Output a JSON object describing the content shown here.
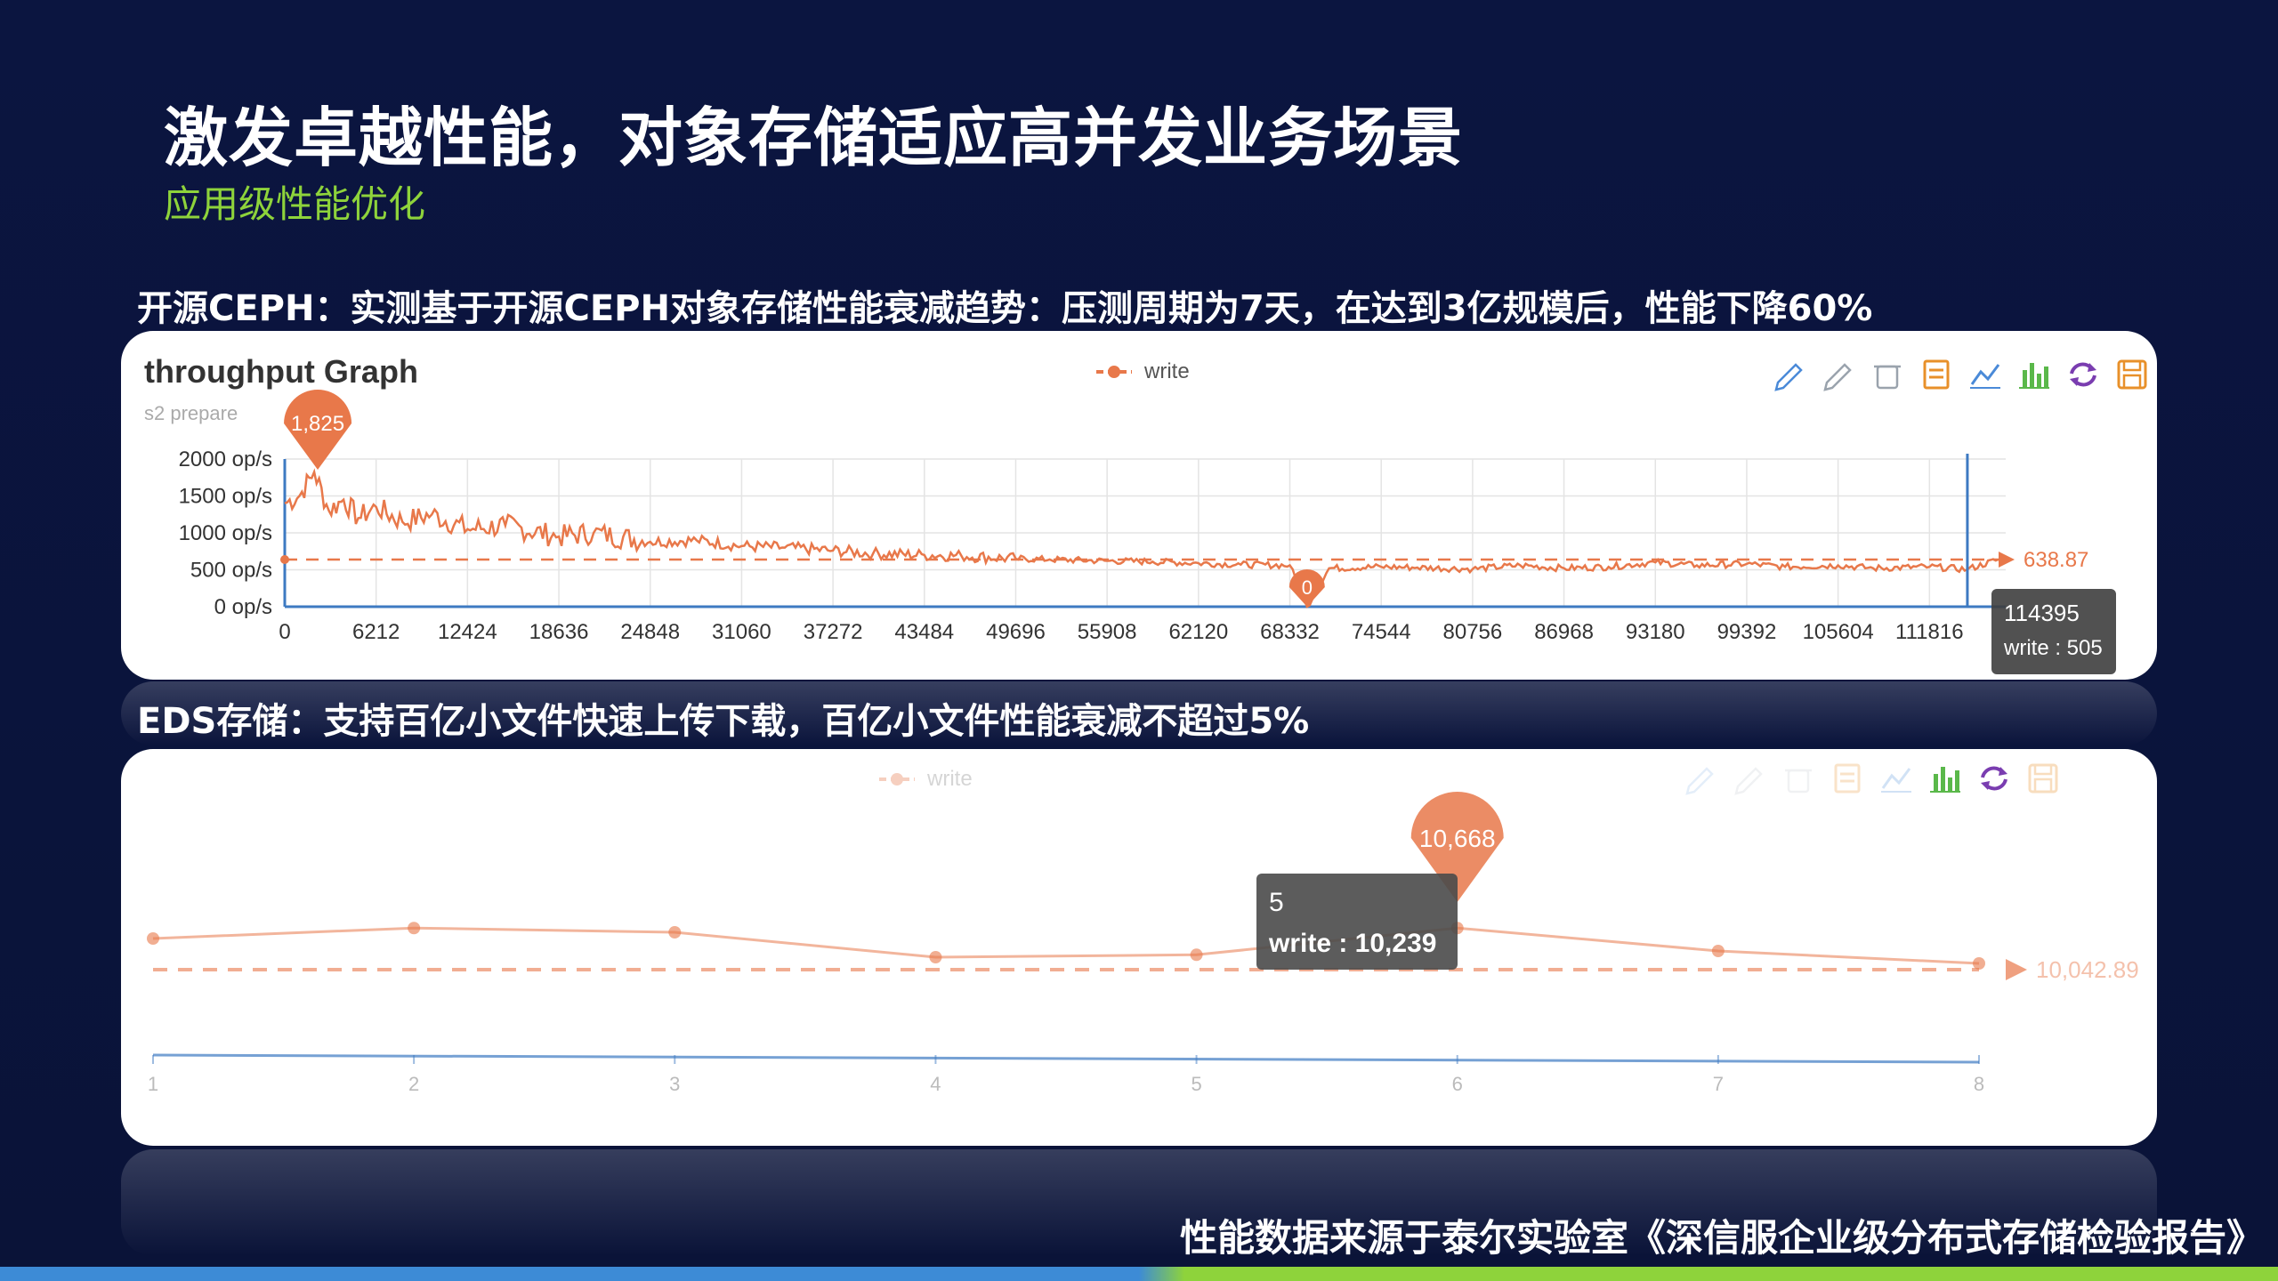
{
  "slide": {
    "title": "激发卓越性能，对象存储适应高并发业务场景",
    "subtitle": "应用级性能优化",
    "ceph_heading": "开源CEPH：实测基于开源CEPH对象存储性能衰减趋势：压测周期为7天，在达到3亿规模后，性能下降60%",
    "eds_heading": "EDS存储：支持百亿小文件快速上传下载，百亿小文件性能衰减不超过5%",
    "footer_note": "性能数据来源于泰尔实验室《深信服企业级分布式存储检验报告》"
  },
  "colors": {
    "series": "#e8784a",
    "axis": "#3d7ac2",
    "title": "#ffffff",
    "subtitle": "#8ed33b",
    "background": "#0b1540"
  },
  "toolbar_icons": [
    "mark-pen-icon",
    "erase-pen-icon",
    "clear-icon",
    "data-view-icon",
    "line-chart-icon",
    "bar-chart-icon",
    "refresh-icon",
    "save-icon"
  ],
  "chart_data": [
    {
      "type": "line",
      "title": "throughput Graph",
      "subtitle": "s2 prepare",
      "legend": [
        "write"
      ],
      "legend_position": "top-center",
      "y_ticks": [
        "2000 op/s",
        "1500 op/s",
        "1000 op/s",
        "500 op/s",
        "0 op/s"
      ],
      "ylim": [
        0,
        2000
      ],
      "x_ticks": [
        "0",
        "6212",
        "12424",
        "18636",
        "24848",
        "31060",
        "37272",
        "43484",
        "49696",
        "55908",
        "62120",
        "68332",
        "74544",
        "80756",
        "86968",
        "93180",
        "99392",
        "105604",
        "111816"
      ],
      "xlim": [
        0,
        117000
      ],
      "grid": true,
      "series": [
        {
          "name": "write",
          "x": [
            0,
            1000,
            2000,
            3000,
            4000,
            5000,
            6212,
            8000,
            10000,
            12424,
            15000,
            18636,
            21000,
            24848,
            28000,
            31060,
            34000,
            37272,
            40000,
            43484,
            46000,
            49696,
            52000,
            55908,
            59000,
            62120,
            65000,
            68332,
            69500,
            71000,
            74544,
            77000,
            80756,
            84000,
            86968,
            90000,
            93180,
            96000,
            99392,
            102000,
            105604,
            108000,
            111816,
            114395,
            116500
          ],
          "y": [
            1400,
            1500,
            1825,
            1300,
            1450,
            1200,
            1350,
            1150,
            1250,
            1050,
            1100,
            950,
            1000,
            880,
            900,
            820,
            800,
            760,
            720,
            700,
            690,
            650,
            640,
            620,
            610,
            590,
            570,
            560,
            0,
            520,
            540,
            530,
            510,
            560,
            520,
            540,
            600,
            560,
            580,
            540,
            560,
            520,
            540,
            505,
            638.87
          ]
        }
      ],
      "annotations": [
        {
          "type": "max",
          "label": "1,825",
          "x": 2000,
          "y": 1825
        },
        {
          "type": "min",
          "label": "0",
          "x": 69500,
          "y": 0
        },
        {
          "type": "average",
          "label": "638.87",
          "y": 638.87
        }
      ],
      "tooltip": {
        "x_label": "114395",
        "series": "write",
        "value": 505,
        "text": "write : 505"
      }
    },
    {
      "type": "line",
      "legend": [
        "write"
      ],
      "legend_position": "top-center",
      "x_ticks": [
        "1",
        "2",
        "3",
        "4",
        "5",
        "6",
        "7",
        "8"
      ],
      "grid": false,
      "series": [
        {
          "name": "write",
          "x": [
            1,
            2,
            3,
            4,
            5,
            6,
            7,
            8
          ],
          "y": [
            10500,
            10668,
            10600,
            10200,
            10239,
            10668,
            10300,
            10100
          ]
        }
      ],
      "annotations": [
        {
          "type": "max",
          "label": "10,668",
          "x": 6,
          "y": 10668
        },
        {
          "type": "average",
          "label": "10,042.89",
          "y": 10042.89
        }
      ],
      "tooltip": {
        "x_label": "5",
        "series": "write",
        "value": 10239,
        "text": "write : 10,239"
      }
    }
  ]
}
